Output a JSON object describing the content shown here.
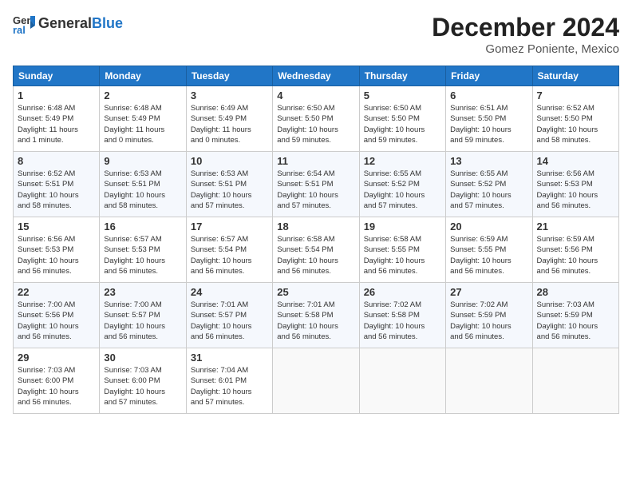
{
  "header": {
    "logo_general": "General",
    "logo_blue": "Blue",
    "month_title": "December 2024",
    "location": "Gomez Poniente, Mexico"
  },
  "calendar": {
    "headers": [
      "Sunday",
      "Monday",
      "Tuesday",
      "Wednesday",
      "Thursday",
      "Friday",
      "Saturday"
    ],
    "rows": [
      [
        {
          "day": "1",
          "info": "Sunrise: 6:48 AM\nSunset: 5:49 PM\nDaylight: 11 hours\nand 1 minute."
        },
        {
          "day": "2",
          "info": "Sunrise: 6:48 AM\nSunset: 5:49 PM\nDaylight: 11 hours\nand 0 minutes."
        },
        {
          "day": "3",
          "info": "Sunrise: 6:49 AM\nSunset: 5:49 PM\nDaylight: 11 hours\nand 0 minutes."
        },
        {
          "day": "4",
          "info": "Sunrise: 6:50 AM\nSunset: 5:50 PM\nDaylight: 10 hours\nand 59 minutes."
        },
        {
          "day": "5",
          "info": "Sunrise: 6:50 AM\nSunset: 5:50 PM\nDaylight: 10 hours\nand 59 minutes."
        },
        {
          "day": "6",
          "info": "Sunrise: 6:51 AM\nSunset: 5:50 PM\nDaylight: 10 hours\nand 59 minutes."
        },
        {
          "day": "7",
          "info": "Sunrise: 6:52 AM\nSunset: 5:50 PM\nDaylight: 10 hours\nand 58 minutes."
        }
      ],
      [
        {
          "day": "8",
          "info": "Sunrise: 6:52 AM\nSunset: 5:51 PM\nDaylight: 10 hours\nand 58 minutes."
        },
        {
          "day": "9",
          "info": "Sunrise: 6:53 AM\nSunset: 5:51 PM\nDaylight: 10 hours\nand 58 minutes."
        },
        {
          "day": "10",
          "info": "Sunrise: 6:53 AM\nSunset: 5:51 PM\nDaylight: 10 hours\nand 57 minutes."
        },
        {
          "day": "11",
          "info": "Sunrise: 6:54 AM\nSunset: 5:51 PM\nDaylight: 10 hours\nand 57 minutes."
        },
        {
          "day": "12",
          "info": "Sunrise: 6:55 AM\nSunset: 5:52 PM\nDaylight: 10 hours\nand 57 minutes."
        },
        {
          "day": "13",
          "info": "Sunrise: 6:55 AM\nSunset: 5:52 PM\nDaylight: 10 hours\nand 57 minutes."
        },
        {
          "day": "14",
          "info": "Sunrise: 6:56 AM\nSunset: 5:53 PM\nDaylight: 10 hours\nand 56 minutes."
        }
      ],
      [
        {
          "day": "15",
          "info": "Sunrise: 6:56 AM\nSunset: 5:53 PM\nDaylight: 10 hours\nand 56 minutes."
        },
        {
          "day": "16",
          "info": "Sunrise: 6:57 AM\nSunset: 5:53 PM\nDaylight: 10 hours\nand 56 minutes."
        },
        {
          "day": "17",
          "info": "Sunrise: 6:57 AM\nSunset: 5:54 PM\nDaylight: 10 hours\nand 56 minutes."
        },
        {
          "day": "18",
          "info": "Sunrise: 6:58 AM\nSunset: 5:54 PM\nDaylight: 10 hours\nand 56 minutes."
        },
        {
          "day": "19",
          "info": "Sunrise: 6:58 AM\nSunset: 5:55 PM\nDaylight: 10 hours\nand 56 minutes."
        },
        {
          "day": "20",
          "info": "Sunrise: 6:59 AM\nSunset: 5:55 PM\nDaylight: 10 hours\nand 56 minutes."
        },
        {
          "day": "21",
          "info": "Sunrise: 6:59 AM\nSunset: 5:56 PM\nDaylight: 10 hours\nand 56 minutes."
        }
      ],
      [
        {
          "day": "22",
          "info": "Sunrise: 7:00 AM\nSunset: 5:56 PM\nDaylight: 10 hours\nand 56 minutes."
        },
        {
          "day": "23",
          "info": "Sunrise: 7:00 AM\nSunset: 5:57 PM\nDaylight: 10 hours\nand 56 minutes."
        },
        {
          "day": "24",
          "info": "Sunrise: 7:01 AM\nSunset: 5:57 PM\nDaylight: 10 hours\nand 56 minutes."
        },
        {
          "day": "25",
          "info": "Sunrise: 7:01 AM\nSunset: 5:58 PM\nDaylight: 10 hours\nand 56 minutes."
        },
        {
          "day": "26",
          "info": "Sunrise: 7:02 AM\nSunset: 5:58 PM\nDaylight: 10 hours\nand 56 minutes."
        },
        {
          "day": "27",
          "info": "Sunrise: 7:02 AM\nSunset: 5:59 PM\nDaylight: 10 hours\nand 56 minutes."
        },
        {
          "day": "28",
          "info": "Sunrise: 7:03 AM\nSunset: 5:59 PM\nDaylight: 10 hours\nand 56 minutes."
        }
      ],
      [
        {
          "day": "29",
          "info": "Sunrise: 7:03 AM\nSunset: 6:00 PM\nDaylight: 10 hours\nand 56 minutes."
        },
        {
          "day": "30",
          "info": "Sunrise: 7:03 AM\nSunset: 6:00 PM\nDaylight: 10 hours\nand 57 minutes."
        },
        {
          "day": "31",
          "info": "Sunrise: 7:04 AM\nSunset: 6:01 PM\nDaylight: 10 hours\nand 57 minutes."
        },
        {
          "day": "",
          "info": ""
        },
        {
          "day": "",
          "info": ""
        },
        {
          "day": "",
          "info": ""
        },
        {
          "day": "",
          "info": ""
        }
      ]
    ]
  }
}
